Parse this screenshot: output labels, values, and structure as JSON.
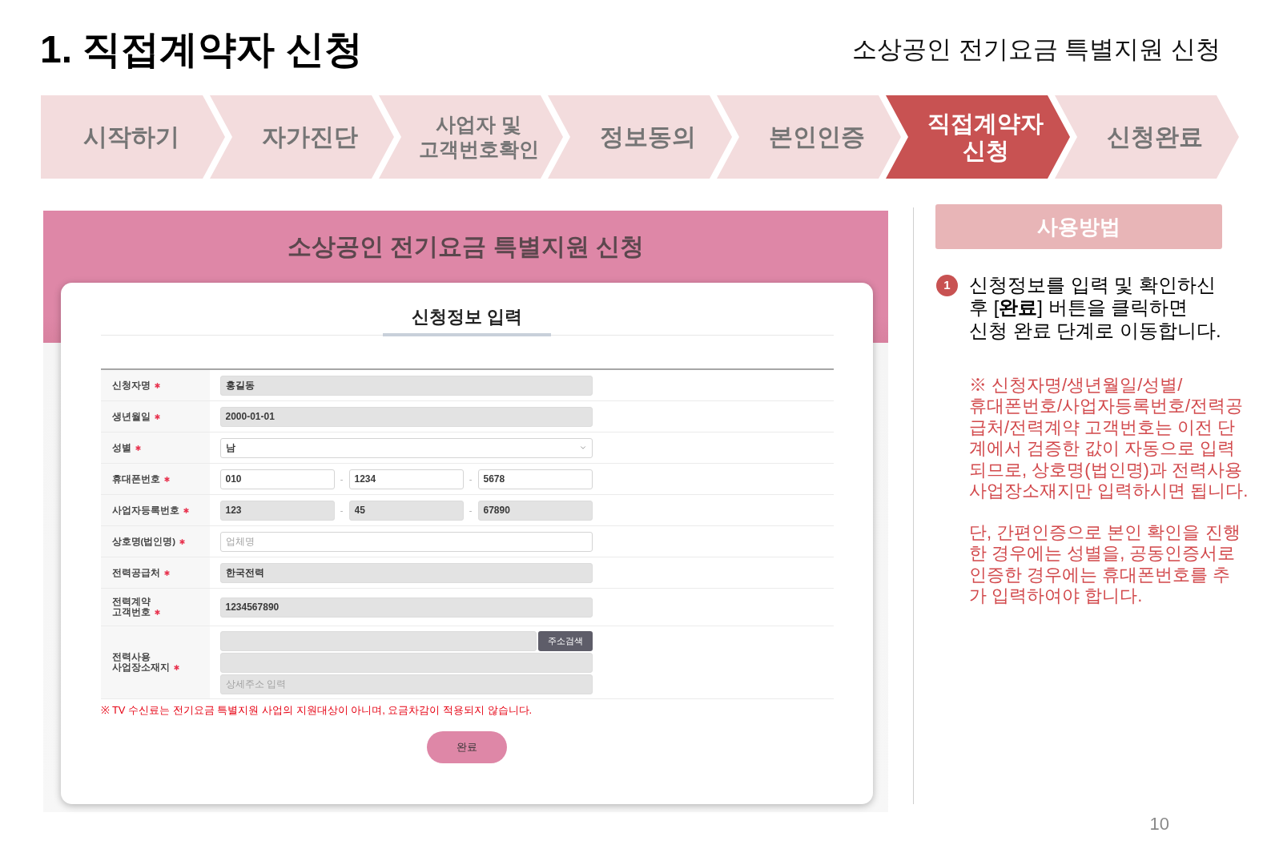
{
  "page": {
    "title": "1. 직접계약자 신청",
    "subtitle": "소상공인 전기요금 특별지원 신청",
    "page_number": "10"
  },
  "steps": [
    {
      "label": "시작하기",
      "selected": false
    },
    {
      "label": "자가진단",
      "selected": false
    },
    {
      "label": "사업자 및\n고객번호확인",
      "selected": false
    },
    {
      "label": "정보동의",
      "selected": false
    },
    {
      "label": "본인인증",
      "selected": false
    },
    {
      "label": "직접계약자\n신청",
      "selected": true
    },
    {
      "label": "신청완료",
      "selected": false
    }
  ],
  "form_panel": {
    "title": "소상공인 전기요금 특별지원 신청",
    "section_heading": "신청정보 입력",
    "rows": [
      {
        "kind": "text",
        "label": "신청자명",
        "required": true,
        "fields": [
          {
            "value": "홍길동",
            "readonly": true
          }
        ]
      },
      {
        "kind": "text",
        "label": "생년월일",
        "required": true,
        "fields": [
          {
            "value": "2000-01-01",
            "readonly": true
          }
        ]
      },
      {
        "kind": "select",
        "label": "성별",
        "required": true,
        "fields": [
          {
            "value": "남",
            "readonly": false
          }
        ]
      },
      {
        "kind": "split",
        "label": "휴대폰번호",
        "required": true,
        "separator": "-",
        "fields": [
          {
            "value": "010",
            "readonly": false
          },
          {
            "value": "1234",
            "readonly": false
          },
          {
            "value": "5678",
            "readonly": false
          }
        ]
      },
      {
        "kind": "split",
        "label": "사업자등록번호",
        "required": true,
        "separator": "-",
        "fields": [
          {
            "value": "123",
            "readonly": true
          },
          {
            "value": "45",
            "readonly": true
          },
          {
            "value": "67890",
            "readonly": true
          }
        ]
      },
      {
        "kind": "text",
        "label": "상호명(법인명)",
        "required": true,
        "fields": [
          {
            "placeholder": "업체명",
            "readonly": false
          }
        ]
      },
      {
        "kind": "text",
        "label": "전력공급처",
        "required": true,
        "fields": [
          {
            "value": "한국전력",
            "readonly": true
          }
        ]
      },
      {
        "kind": "text",
        "label": "전력계약\n고객번호",
        "required": true,
        "fields": [
          {
            "value": "1234567890",
            "readonly": true
          }
        ]
      },
      {
        "kind": "address",
        "label": "전력사용\n사업장소재지",
        "required": true,
        "search_button": "주소검색",
        "fields": [
          {
            "readonly": true
          },
          {
            "readonly": true
          },
          {
            "placeholder": "상세주소 입력",
            "readonly": true
          }
        ]
      }
    ],
    "notice": "※ TV 수신료는 전기요금 특별지원 사업의 지원대상이 아니며, 요금차감이 적용되지 않습니다.",
    "submit_button": "완료"
  },
  "help": {
    "title": "사용방법",
    "items": [
      {
        "number": "1",
        "text": "신청정보를 입력 및 확인하신\n후 [**완료**] 버튼을 클릭하면\n신청 완료 단계로 이동합니다."
      }
    ],
    "notes": [
      "※ 신청자명/생년월일/성별/\n휴대폰번호/사업자등록번호/전력공\n급처/전력계약 고객번호는 이전 단\n계에서 검증한 값이 자동으로 입력\n되므로, 상호명(법인명)과 전력사용\n사업장소재지만 입력하시면 됩니다.",
      "단, 간편인증으로 본인 확인을 진행\n한 경우에는 성별을, 공동인증서로\n인증한 경우에는 휴대폰번호를 추\n가 입력하여야 합니다."
    ]
  }
}
